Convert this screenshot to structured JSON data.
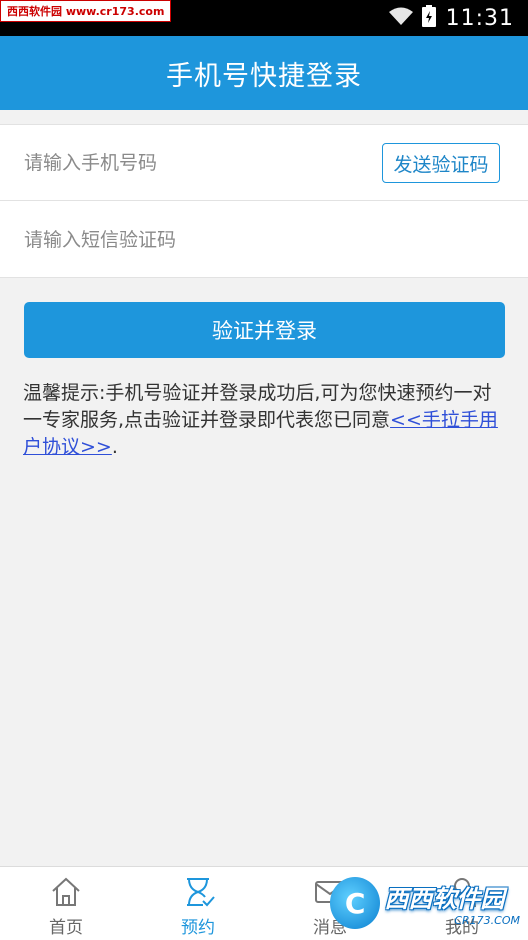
{
  "status_bar": {
    "time": "11:31",
    "watermark": "西西软件园 www.cr173.com"
  },
  "header": {
    "title": "手机号快捷登录"
  },
  "form": {
    "phone_placeholder": "请输入手机号码",
    "code_placeholder": "请输入短信验证码",
    "send_code_label": "发送验证码"
  },
  "submit_label": "验证并登录",
  "tip": {
    "text": "温馨提示:手机号验证并登录成功后,可为您快速预约一对一专家服务,点击验证并登录即代表您已同意",
    "link": "<<手拉手用户协议>>",
    "suffix": "."
  },
  "bottom_nav": {
    "items": [
      {
        "label": "首页",
        "icon": "home-icon"
      },
      {
        "label": "预约",
        "icon": "appointment-icon"
      },
      {
        "label": "消息",
        "icon": "mail-icon"
      },
      {
        "label": "我的",
        "icon": "user-icon"
      }
    ],
    "active_index": 1
  },
  "watermark_bottom": {
    "main": "西西软件园",
    "sub": "CR173.COM"
  },
  "colors": {
    "primary": "#1e96dc",
    "link": "#2f4fd8",
    "background": "#f2f2f2"
  }
}
